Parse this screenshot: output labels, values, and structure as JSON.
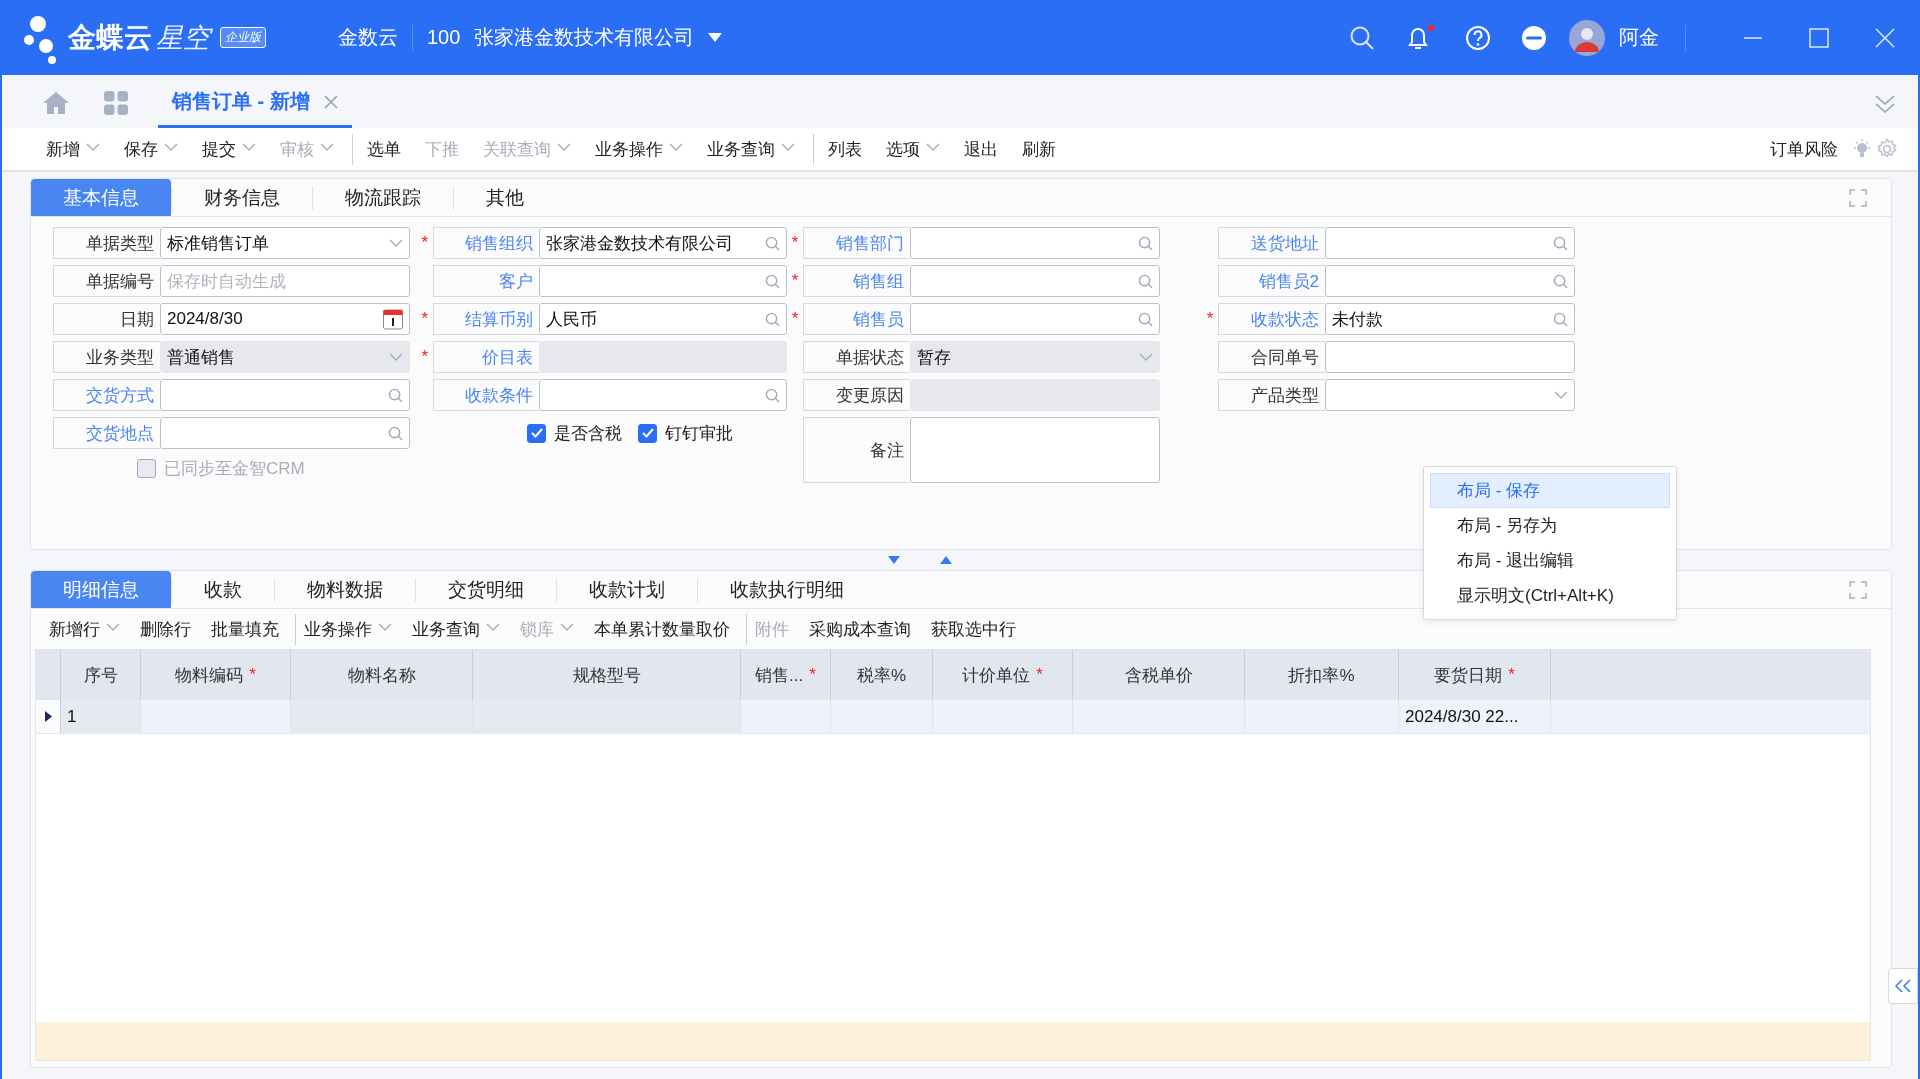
{
  "header": {
    "product": "金蝶云",
    "product_sub": "星空",
    "edition": "企业版",
    "tenant": "金数云",
    "org_code": "100",
    "org_name": "张家港金数技术有限公司",
    "notification_unread": true,
    "user": "阿金"
  },
  "doc_tabs": [
    {
      "label": "销售订单 - 新增",
      "selected": true
    }
  ],
  "toolbar": [
    {
      "label": "新增",
      "dropdown": true,
      "disabled": false,
      "divider_before": false
    },
    {
      "label": "保存",
      "dropdown": true,
      "disabled": false,
      "divider_before": false
    },
    {
      "label": "提交",
      "dropdown": true,
      "disabled": false,
      "divider_before": false
    },
    {
      "label": "审核",
      "dropdown": true,
      "disabled": true,
      "divider_before": false
    },
    {
      "label": "选单",
      "dropdown": false,
      "disabled": false,
      "divider_before": true
    },
    {
      "label": "下推",
      "dropdown": false,
      "disabled": true,
      "divider_before": false
    },
    {
      "label": "关联查询",
      "dropdown": true,
      "disabled": true,
      "divider_before": false
    },
    {
      "label": "业务操作",
      "dropdown": true,
      "disabled": false,
      "divider_before": false
    },
    {
      "label": "业务查询",
      "dropdown": true,
      "disabled": false,
      "divider_before": false
    },
    {
      "label": "列表",
      "dropdown": false,
      "disabled": false,
      "divider_before": true
    },
    {
      "label": "选项",
      "dropdown": true,
      "disabled": false,
      "divider_before": false
    },
    {
      "label": "退出",
      "dropdown": false,
      "disabled": false,
      "divider_before": false
    },
    {
      "label": "刷新",
      "dropdown": false,
      "disabled": false,
      "divider_before": false
    }
  ],
  "toolbar_right": {
    "label": "订单风险"
  },
  "form_tabs": [
    {
      "label": "基本信息",
      "selected": true
    },
    {
      "label": "财务信息",
      "selected": false
    },
    {
      "label": "物流跟踪",
      "selected": false
    },
    {
      "label": "其他",
      "selected": false
    }
  ],
  "form_columns": [
    [
      {
        "kind": "select",
        "label": "单据类型",
        "link": false,
        "disabled": false,
        "value": "标准销售订单"
      },
      {
        "kind": "text",
        "label": "单据编号",
        "link": false,
        "disabled": false,
        "placeholder": "保存时自动生成"
      },
      {
        "kind": "date",
        "label": "日期",
        "link": false,
        "disabled": false,
        "value": "2024/8/30"
      },
      {
        "kind": "select",
        "label": "业务类型",
        "link": false,
        "disabled": true,
        "value": "普通销售"
      },
      {
        "kind": "lookup",
        "label": "交货方式",
        "link": true,
        "disabled": false
      },
      {
        "kind": "lookup",
        "label": "交货地点",
        "link": true,
        "disabled": false
      },
      {
        "kind": "checkbox",
        "label": "已同步至金智CRM",
        "checked": false,
        "disabled": true
      }
    ],
    [
      {
        "kind": "lookup",
        "label": "销售组织",
        "marker": "*",
        "link": true,
        "disabled": false,
        "value": "张家港金数技术有限公司"
      },
      {
        "kind": "lookup",
        "label": "客户",
        "link": true,
        "disabled": false
      },
      {
        "kind": "lookup",
        "label": "结算币别",
        "marker": "*",
        "link": true,
        "disabled": false,
        "value": "人民币"
      },
      {
        "kind": "text",
        "label": "价目表",
        "marker": "*",
        "link": true,
        "disabled": true
      },
      {
        "kind": "lookup",
        "label": "收款条件",
        "link": true,
        "disabled": false
      },
      {
        "kind": "checkboxes",
        "items": [
          {
            "label": "是否含税",
            "checked": true
          },
          {
            "label": "钉钉审批",
            "checked": true
          }
        ]
      }
    ],
    [
      {
        "kind": "lookup",
        "label": "销售部门",
        "marker": "*",
        "link": true,
        "disabled": false
      },
      {
        "kind": "lookup",
        "label": "销售组",
        "marker": "*",
        "link": true,
        "disabled": false
      },
      {
        "kind": "lookup",
        "label": "销售员",
        "marker": "*",
        "link": true,
        "disabled": false
      },
      {
        "kind": "select",
        "label": "单据状态",
        "link": false,
        "disabled": true,
        "value": "暂存"
      },
      {
        "kind": "text",
        "label": "变更原因",
        "link": false,
        "disabled": true
      },
      {
        "kind": "memo",
        "label": "备注",
        "link": false,
        "disabled": false
      }
    ],
    [
      {
        "kind": "lookup",
        "label": "送货地址",
        "link": true,
        "disabled": false
      },
      {
        "kind": "lookup",
        "label": "销售员2",
        "link": true,
        "disabled": false
      },
      {
        "kind": "lookup",
        "label": "收款状态",
        "marker": "*",
        "link": true,
        "disabled": false,
        "value": "未付款"
      },
      {
        "kind": "text",
        "label": "合同单号",
        "link": false,
        "disabled": false
      },
      {
        "kind": "select",
        "label": "产品类型",
        "link": false,
        "disabled": false
      }
    ]
  ],
  "context_menu": [
    {
      "label": "布局 - 保存",
      "selected": true
    },
    {
      "label": "布局 - 另存为",
      "selected": false
    },
    {
      "label": "布局 - 退出编辑",
      "selected": false
    },
    {
      "label": "显示明文(Ctrl+Alt+K)",
      "selected": false
    }
  ],
  "detail_tabs": [
    {
      "label": "明细信息",
      "selected": true
    },
    {
      "label": "收款",
      "selected": false
    },
    {
      "label": "物料数据",
      "selected": false
    },
    {
      "label": "交货明细",
      "selected": false
    },
    {
      "label": "收款计划",
      "selected": false
    },
    {
      "label": "收款执行明细",
      "selected": false
    }
  ],
  "detail_toolbar": [
    {
      "label": "新增行",
      "dropdown": true,
      "disabled": false,
      "divider_before": false
    },
    {
      "label": "删除行",
      "dropdown": false,
      "disabled": false,
      "divider_before": false
    },
    {
      "label": "批量填充",
      "dropdown": false,
      "disabled": false,
      "divider_before": false
    },
    {
      "label": "业务操作",
      "dropdown": true,
      "disabled": false,
      "divider_before": true
    },
    {
      "label": "业务查询",
      "dropdown": true,
      "disabled": false,
      "divider_before": false
    },
    {
      "label": "锁库",
      "dropdown": true,
      "disabled": true,
      "divider_before": false
    },
    {
      "label": "本单累计数量取价",
      "dropdown": false,
      "disabled": false,
      "divider_before": false
    },
    {
      "label": "附件",
      "dropdown": false,
      "disabled": true,
      "divider_before": true
    },
    {
      "label": "采购成本查询",
      "dropdown": false,
      "disabled": false,
      "divider_before": false
    },
    {
      "label": "获取选中行",
      "dropdown": false,
      "disabled": false,
      "divider_before": false
    }
  ],
  "table": {
    "columns": [
      {
        "label": "序号",
        "locked": true
      },
      {
        "label": "物料编码",
        "marker": "*",
        "locked": false
      },
      {
        "label": "物料名称",
        "locked": true
      },
      {
        "label": "规格型号",
        "locked": true
      },
      {
        "label": "销售...",
        "marker": "*",
        "locked": false
      },
      {
        "label": "税率%",
        "locked": false
      },
      {
        "label": "计价单位",
        "marker": "*",
        "locked": false
      },
      {
        "label": "含税单价",
        "locked": false
      },
      {
        "label": "折扣率%",
        "locked": false
      },
      {
        "label": "要货日期",
        "marker": "*",
        "locked": false
      }
    ],
    "rows": [
      {
        "current": true,
        "cells": [
          "1",
          "",
          "",
          "",
          "",
          "",
          "",
          "",
          "",
          "2024/8/30 22..."
        ]
      }
    ]
  }
}
